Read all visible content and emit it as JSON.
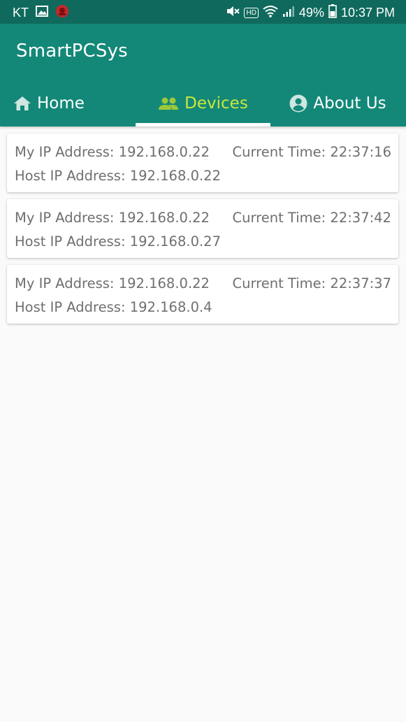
{
  "status_bar": {
    "carrier": "KT",
    "battery": "49%",
    "time": "10:37 PM",
    "icons": [
      "gallery-icon",
      "notification-icon",
      "mute-icon",
      "hd-icon",
      "wifi-icon",
      "signal-icon",
      "battery-icon"
    ],
    "hd_label": "HD"
  },
  "app_bar": {
    "title": "SmartPCSys"
  },
  "tabs": [
    {
      "label": "Home",
      "icon": "home-icon",
      "selected": false
    },
    {
      "label": "Devices",
      "icon": "people-icon",
      "selected": true
    },
    {
      "label": "About Us",
      "icon": "account-circle-icon",
      "selected": false
    }
  ],
  "colors": {
    "status_bar": "#0f6a5d",
    "primary": "#138878",
    "selected_tab": "#c9e83a",
    "text_gray": "#6f6f6f",
    "background": "#fafafa"
  },
  "devices": [
    {
      "my_ip": "My IP Address: 192.168.0.22",
      "current_time": "Current Time: 22:37:16",
      "host_ip": "Host IP Address: 192.168.0.22"
    },
    {
      "my_ip": "My IP Address: 192.168.0.22",
      "current_time": "Current Time: 22:37:42",
      "host_ip": "Host IP Address: 192.168.0.27"
    },
    {
      "my_ip": "My IP Address: 192.168.0.22",
      "current_time": "Current Time: 22:37:37",
      "host_ip": "Host IP Address: 192.168.0.4"
    }
  ]
}
